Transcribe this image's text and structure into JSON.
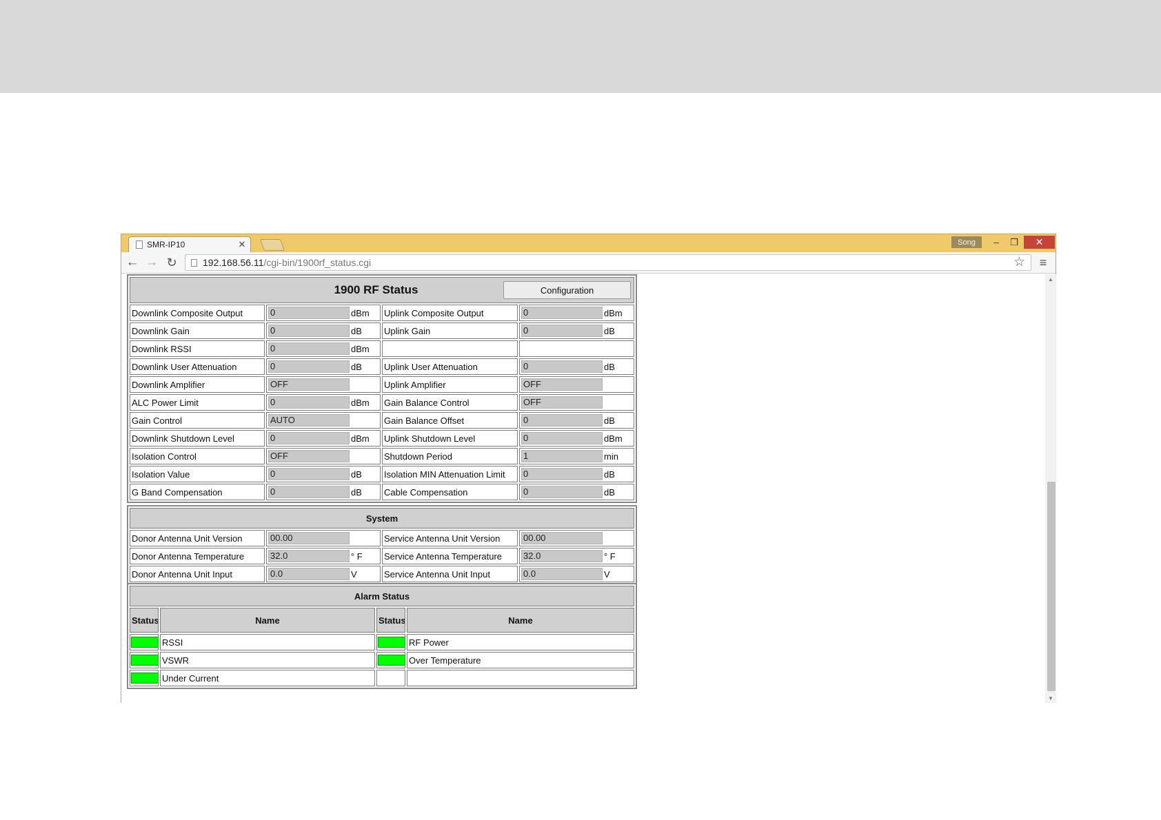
{
  "browser": {
    "tab_title": "SMR-IP10",
    "user_badge": "Song",
    "url_host": "192.168.56.11",
    "url_path": "/cgi-bin/1900rf_status.cgi"
  },
  "rf_status": {
    "title": "1900 RF Status",
    "config_button": "Configuration",
    "rows": [
      {
        "l_label": "Downlink Composite Output",
        "l_value": "0",
        "l_unit": "dBm",
        "r_label": "Uplink Composite Output",
        "r_value": "0",
        "r_unit": "dBm"
      },
      {
        "l_label": "Downlink Gain",
        "l_value": "0",
        "l_unit": "dB",
        "r_label": "Uplink Gain",
        "r_value": "0",
        "r_unit": "dB"
      },
      {
        "l_label": "Downlink RSSI",
        "l_value": "0",
        "l_unit": "dBm",
        "r_label": "",
        "r_value": "",
        "r_unit": ""
      },
      {
        "l_label": "Downlink User Attenuation",
        "l_value": "0",
        "l_unit": "dB",
        "r_label": "Uplink User Attenuation",
        "r_value": "0",
        "r_unit": "dB"
      },
      {
        "l_label": "Downlink Amplifier",
        "l_value": "OFF",
        "l_unit": "",
        "r_label": "Uplink Amplifier",
        "r_value": "OFF",
        "r_unit": ""
      },
      {
        "l_label": "ALC Power Limit",
        "l_value": "0",
        "l_unit": "dBm",
        "r_label": "Gain Balance Control",
        "r_value": "OFF",
        "r_unit": ""
      },
      {
        "l_label": "Gain Control",
        "l_value": "AUTO",
        "l_unit": "",
        "r_label": "Gain Balance Offset",
        "r_value": "0",
        "r_unit": "dB"
      },
      {
        "l_label": "Downlink Shutdown Level",
        "l_value": "0",
        "l_unit": "dBm",
        "r_label": "Uplink Shutdown Level",
        "r_value": "0",
        "r_unit": "dBm"
      },
      {
        "l_label": "Isolation Control",
        "l_value": "OFF",
        "l_unit": "",
        "r_label": "Shutdown Period",
        "r_value": "1",
        "r_unit": "min"
      },
      {
        "l_label": "Isolation Value",
        "l_value": "0",
        "l_unit": "dB",
        "r_label": "Isolation MIN Attenuation Limit",
        "r_value": "0",
        "r_unit": "dB"
      },
      {
        "l_label": "G Band Compensation",
        "l_value": "0",
        "l_unit": "dB",
        "r_label": "Cable Compensation",
        "r_value": "0",
        "r_unit": "dB"
      }
    ]
  },
  "system": {
    "title": "System",
    "rows": [
      {
        "l_label": "Donor Antenna Unit Version",
        "l_value": "00.00",
        "l_unit": "",
        "r_label": "Service Antenna Unit Version",
        "r_value": "00.00",
        "r_unit": ""
      },
      {
        "l_label": "Donor Antenna Temperature",
        "l_value": "32.0",
        "l_unit": "° F",
        "r_label": "Service Antenna Temperature",
        "r_value": "32.0",
        "r_unit": "° F"
      },
      {
        "l_label": "Donor Antenna Unit Input",
        "l_value": "0.0",
        "l_unit": "V",
        "r_label": "Service Antenna Unit Input",
        "r_value": "0.0",
        "r_unit": "V"
      }
    ]
  },
  "alarm": {
    "title": "Alarm Status",
    "col_status": "Status",
    "col_name": "Name",
    "status_color": "#00ff00",
    "rows": [
      {
        "l_name": "RSSI",
        "l_ok": true,
        "r_name": "RF Power",
        "r_ok": true
      },
      {
        "l_name": "VSWR",
        "l_ok": true,
        "r_name": "Over Temperature",
        "r_ok": true
      },
      {
        "l_name": "Under Current",
        "l_ok": true,
        "r_name": "",
        "r_ok": false
      }
    ]
  },
  "colors": {
    "titlebar": "#f0c96a",
    "close_button": "#c7433a",
    "status_ok": "#00ff00"
  }
}
